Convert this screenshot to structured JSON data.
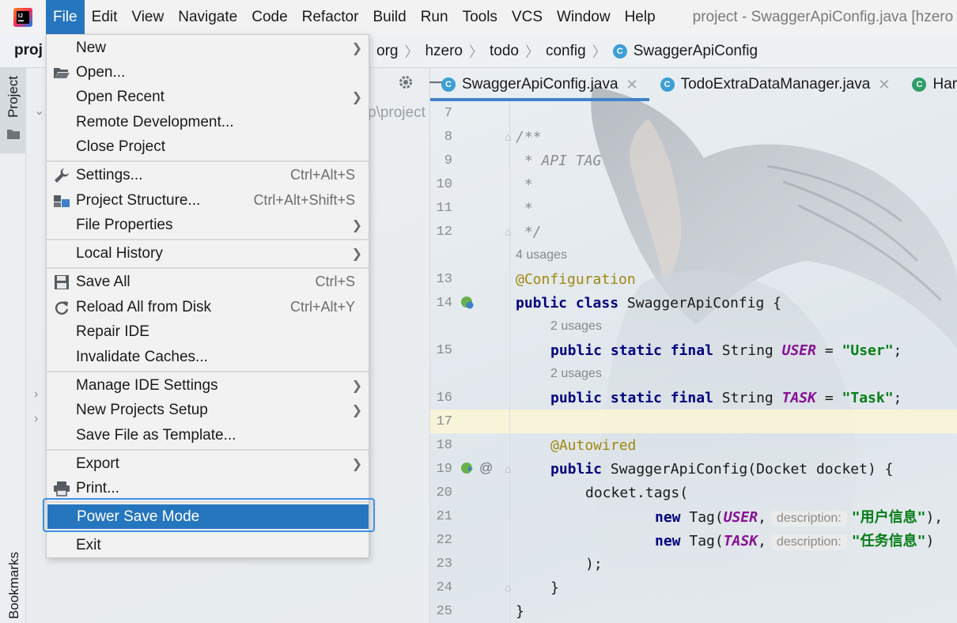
{
  "menubar": {
    "items": [
      "File",
      "Edit",
      "View",
      "Navigate",
      "Code",
      "Refactor",
      "Build",
      "Run",
      "Tools",
      "VCS",
      "Window",
      "Help"
    ],
    "window_title": "project - SwaggerApiConfig.java [hzero"
  },
  "navbar": {
    "project_name": "proj",
    "breadcrumb": [
      "org",
      "hzero",
      "todo",
      "config",
      "SwaggerApiConfig"
    ]
  },
  "toolstrip": {
    "project_label": "Project",
    "bookmarks_label": "Bookmarks"
  },
  "project_panel": {
    "path_fragment": "p\\project"
  },
  "tabs": [
    {
      "label": "SwaggerApiConfig.java",
      "icon": "class-icon",
      "active": true
    },
    {
      "label": "TodoExtraDataManager.java",
      "icon": "class-icon",
      "active": false
    },
    {
      "label": "Har",
      "icon": "class-icon",
      "active": false
    }
  ],
  "file_menu": {
    "items": [
      {
        "label": "New",
        "submenu": true
      },
      {
        "label": "Open...",
        "icon": "folder-open-icon"
      },
      {
        "label": "Open Recent",
        "submenu": true
      },
      {
        "label": "Remote Development..."
      },
      {
        "label": "Close Project"
      },
      {
        "label": "Settings...",
        "shortcut": "Ctrl+Alt+S",
        "icon": "wrench-icon"
      },
      {
        "label": "Project Structure...",
        "shortcut": "Ctrl+Alt+Shift+S",
        "icon": "project-structure-icon"
      },
      {
        "label": "File Properties",
        "submenu": true
      },
      {
        "label": "Local History",
        "submenu": true
      },
      {
        "label": "Save All",
        "shortcut": "Ctrl+S",
        "icon": "save-icon"
      },
      {
        "label": "Reload All from Disk",
        "shortcut": "Ctrl+Alt+Y",
        "icon": "reload-icon"
      },
      {
        "label": "Repair IDE"
      },
      {
        "label": "Invalidate Caches..."
      },
      {
        "label": "Manage IDE Settings",
        "submenu": true
      },
      {
        "label": "New Projects Setup",
        "submenu": true
      },
      {
        "label": "Save File as Template..."
      },
      {
        "label": "Export",
        "submenu": true
      },
      {
        "label": "Print...",
        "icon": "printer-icon"
      },
      {
        "label": "Power Save Mode",
        "selected": true
      },
      {
        "label": "Exit"
      }
    ]
  },
  "editor": {
    "line_numbers": [
      "7",
      "8",
      "9",
      "10",
      "11",
      "12",
      "13",
      "14",
      "15",
      "16",
      "17",
      "18",
      "19",
      "20",
      "21",
      "22",
      "23",
      "24",
      "25"
    ],
    "comment": [
      "/**",
      " * API TAG",
      " *",
      " *",
      " */"
    ],
    "usages": [
      "4 usages",
      "2 usages",
      "2 usages"
    ],
    "annotation_config": "@Configuration",
    "annotation_autowired": "@Autowired",
    "at_marker": "@",
    "class_decl": {
      "kw1": "public",
      "kw2": "class",
      "name": "SwaggerApiConfig {"
    },
    "field_user": {
      "kw": "public static final",
      "type": "String",
      "name": "USER",
      "eq": "=",
      "value": "\"User\"",
      "end": ";"
    },
    "field_task": {
      "kw": "public static final",
      "type": "String",
      "name": "TASK",
      "eq": "=",
      "value": "\"Task\"",
      "end": ";"
    },
    "ctor": {
      "kw": "public",
      "sig": "SwaggerApiConfig(Docket docket) {"
    },
    "tags_call": "docket.tags(",
    "tag1": {
      "kw": "new",
      "pre": "Tag(",
      "const": "USER",
      "comma": ",",
      "hint": "description:",
      "value": "\"用户信息\"",
      "end": "),"
    },
    "tag2": {
      "kw": "new",
      "pre": "Tag(",
      "const": "TASK",
      "comma": ",",
      "hint": "description:",
      "value": "\"任务信息\"",
      "end": ")"
    },
    "close_paren": ");",
    "close_brace_inner": "}",
    "close_brace_outer": "}"
  }
}
